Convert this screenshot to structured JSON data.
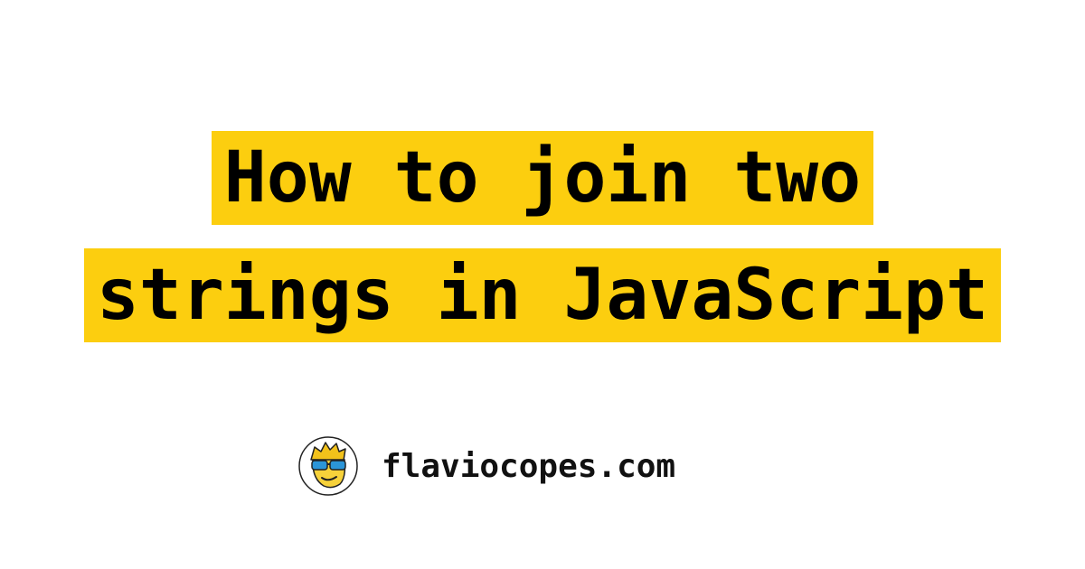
{
  "title": {
    "lines": [
      "How to join two",
      "strings in JavaScript"
    ],
    "highlight_color": "#fcce0f",
    "text_color": "#000000"
  },
  "footer": {
    "avatar_icon": "cartoon-face-with-sunglasses-icon",
    "site_name": "flaviocopes.com"
  }
}
